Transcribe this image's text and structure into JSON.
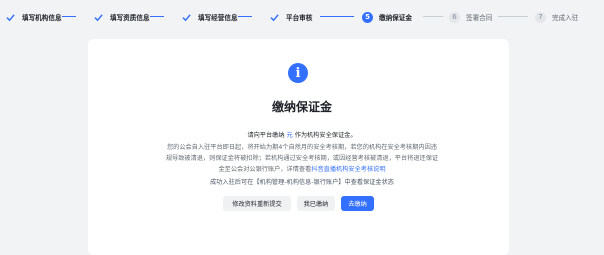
{
  "steps": [
    {
      "label": "填写机构信息",
      "state": "done"
    },
    {
      "label": "填写资质信息",
      "state": "done"
    },
    {
      "label": "填写经营信息",
      "state": "done"
    },
    {
      "label": "平台审核",
      "state": "done"
    },
    {
      "label": "缴纳保证金",
      "state": "current",
      "number": "5"
    },
    {
      "label": "签署合同",
      "state": "todo",
      "number": "6"
    },
    {
      "label": "完成入驻",
      "state": "todo",
      "number": "7"
    }
  ],
  "dialog": {
    "info_glyph": "i",
    "title": "缴纳保证金",
    "line1_prefix": "请向平台缴纳",
    "line1_amount": "元",
    "line1_suffix": "作为机构安全保证金。",
    "para1": "您的公会自入驻平台即日起，将开始为期4个自然月的安全考核期，若您的机构在安全考核期内因违",
    "para2": "规导致被清退，则保证金将被扣除；若机构通过安全考核期，或因经营考核被清退，平台将退还保证",
    "para3_prefix": "金至公会对公银行账户，详情查看",
    "para3_link": "抖音直播机构安全考核说明",
    "para4": "成功入驻后可在【机构管理-机构信息-银行账户】中查看保证金状态",
    "buttons": {
      "edit": "修改资料重新提交",
      "paid": "我已缴纳",
      "pay": "去缴纳"
    }
  },
  "colors": {
    "accent": "#3370ff",
    "background": "#f2f3f5",
    "card": "#ffffff"
  }
}
